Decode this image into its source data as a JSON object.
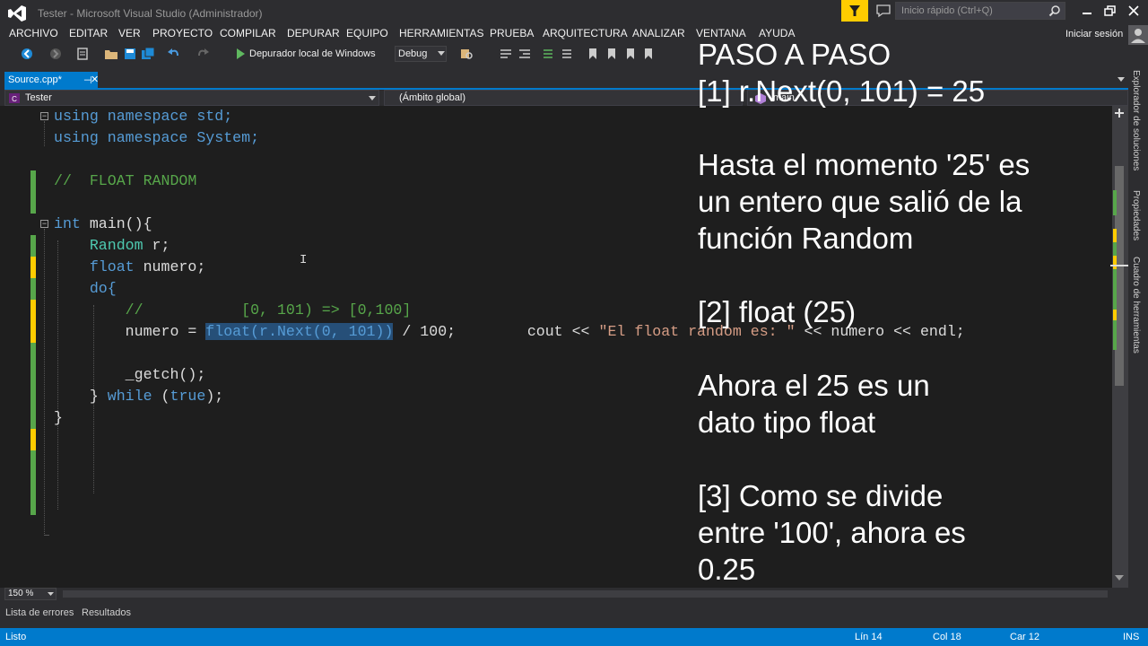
{
  "window": {
    "title": "Tester - Microsoft Visual Studio (Administrador)",
    "quick_launch_placeholder": "Inicio rápido (Ctrl+Q)",
    "sign_in": "Iniciar sesión"
  },
  "menu": [
    "ARCHIVO",
    "EDITAR",
    "VER",
    "PROYECTO",
    "COMPILAR",
    "DEPURAR",
    "EQUIPO",
    "HERRAMIENTAS",
    "PRUEBA",
    "ARQUITECTURA",
    "ANALIZAR",
    "VENTANA",
    "AYUDA"
  ],
  "toolbar": {
    "debugger_label": "Depurador local de Windows",
    "configuration": "Debug"
  },
  "tabs": {
    "active": "Source.cpp*"
  },
  "navbar": {
    "project": "Tester",
    "scope": "(Ámbito global)",
    "member": "main"
  },
  "editor": {
    "zoom": "150 %",
    "lines": {
      "l1": "using namespace std;",
      "l2": "using namespace System;",
      "l4": "//  FLOAT RANDOM",
      "l6a": "int",
      "l6b": " main(){",
      "l7a": "Random",
      "l7b": " r;",
      "l8a": "float",
      "l8b": " numero;",
      "l9": "do{",
      "l10": "//           [0, 101) => [0,100]",
      "l11a": "numero = ",
      "l11sel": "float(r.Next(0, 101))",
      "l11b": " / 100;",
      "l16a": "cout << ",
      "l16str": "\"El float random es: \"",
      "l16b": " << numero << endl;",
      "l18": "_getch();",
      "l19a": "} ",
      "l19kw": "while",
      "l19b": " (",
      "l19true": "true",
      "l19c": ");",
      "l20": "}"
    }
  },
  "overlay": {
    "lines": [
      "PASO A PASO",
      "[1] r.Next(0, 101) = 25",
      "",
      "Hasta el momento '25' es",
      "un entero que salió de la",
      "función Random",
      "",
      "[2] float (25)",
      "",
      "Ahora el 25 es un",
      "dato tipo float",
      "",
      "[3] Como se divide",
      "entre '100', ahora es",
      "0.25"
    ]
  },
  "side_tabs": [
    "Explorador de soluciones",
    "Propiedades",
    "Cuadro de herramientas"
  ],
  "bottom_tabs": [
    "Lista de errores",
    "Resultados"
  ],
  "status": {
    "ready": "Listo",
    "line": "Lín 14",
    "col": "Col 18",
    "car": "Car 12",
    "mode": "INS"
  },
  "colors": {
    "accent": "#007acc",
    "keyword": "#569cd6",
    "type": "#4ec9b0",
    "comment": "#57a64a",
    "string": "#d69d85",
    "selection": "#264f78"
  }
}
